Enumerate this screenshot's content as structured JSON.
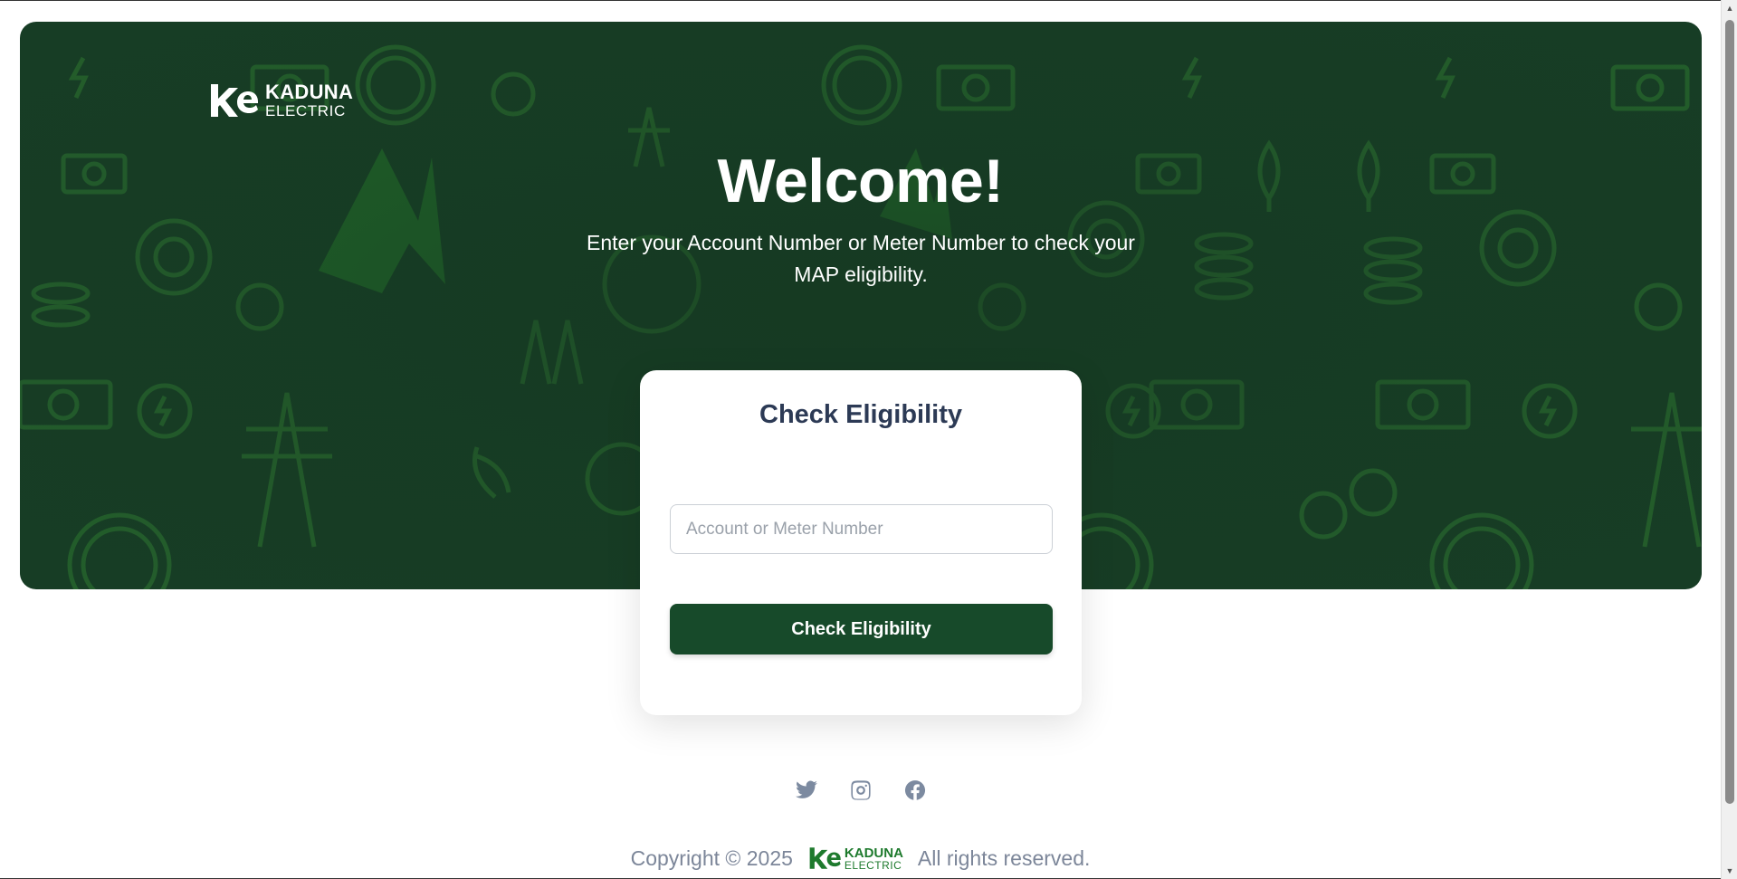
{
  "brand": {
    "name_top": "KADUNA",
    "name_bottom": "ELECTRIC",
    "primary_color": "#174a2a",
    "hero_color": "#173d25",
    "pattern_color": "#2f7a32"
  },
  "hero": {
    "title": "Welcome!",
    "subtitle": "Enter your Account Number or Meter Number to check your MAP eligibility."
  },
  "form": {
    "title": "Check Eligibility",
    "input_placeholder": "Account or Meter Number",
    "input_value": "",
    "submit_label": "Check Eligibility"
  },
  "socials": [
    {
      "name": "twitter-icon"
    },
    {
      "name": "instagram-icon"
    },
    {
      "name": "facebook-icon"
    }
  ],
  "footer": {
    "copyright": "Copyright © 2025",
    "rights": "All rights reserved.",
    "logo_top": "KADUNA",
    "logo_bottom": "ELECTRIC"
  }
}
